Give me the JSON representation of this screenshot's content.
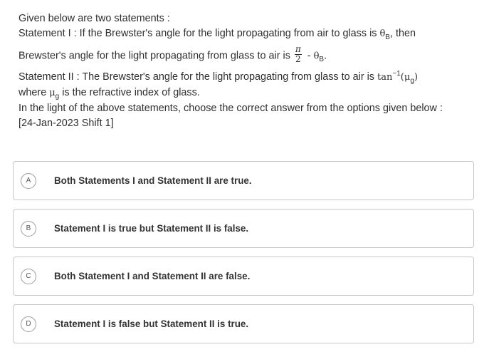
{
  "question": {
    "intro": "Given below are two statements :",
    "s1_prefix": "Statement I : If the Brewster's angle for the light propagating from air to glass is ",
    "theta": "θ",
    "sub_B": "B",
    "s1_suffix": ", then",
    "s1_line2_prefix": "Brewster's angle for the light propagating from glass to air is ",
    "pi": "π",
    "two": "2",
    "minus": " - ",
    "period": ".",
    "s2_prefix": "Statement II : The Brewster's angle for the light propagating from glass to air is ",
    "tan": "tan",
    "sup_neg1": "−1",
    "mu": "μ",
    "sub_g": "g",
    "open_paren": "(",
    "close_paren": ")",
    "s2_line2_prefix": "where ",
    "s2_line2_suffix": " is the refractive index of glass.",
    "instruction": "In the light of the above statements, choose the correct answer from the options given below :",
    "source": "[24-Jan-2023 Shift 1]"
  },
  "options": [
    {
      "letter": "A",
      "text": "Both Statements I and Statement II are true."
    },
    {
      "letter": "B",
      "text": "Statement I is true but Statement II is false."
    },
    {
      "letter": "C",
      "text": "Both Statement I and Statement II are false."
    },
    {
      "letter": "D",
      "text": "Statement I is false but Statement II is true."
    }
  ]
}
